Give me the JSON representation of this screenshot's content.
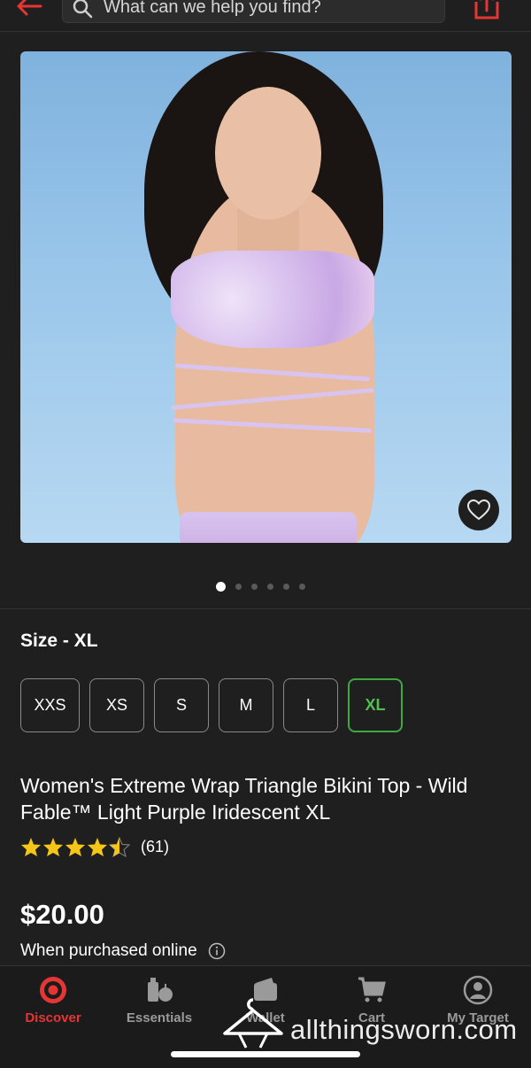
{
  "search": {
    "placeholder": "What can we help you find?"
  },
  "icons": {
    "back": "back-arrow-icon",
    "search": "search-icon",
    "share": "share-icon",
    "favorite": "heart-icon",
    "info": "info-icon"
  },
  "colors": {
    "accent": "#e63535",
    "selected_size": "#3fa83f",
    "star": "#f5c518",
    "background": "#1f1f1f"
  },
  "gallery": {
    "image_count": 6,
    "active_index": 0
  },
  "size": {
    "label": "Size - XL",
    "options": [
      "XXS",
      "XS",
      "S",
      "M",
      "L",
      "XL"
    ],
    "selected": "XL"
  },
  "product": {
    "title": "Women's Extreme Wrap Triangle Bikini Top - Wild Fable™ Light Purple Iridescent XL",
    "rating": 4.5,
    "rating_count": "(61)",
    "price": "$20.00",
    "purchase_note": "When purchased online"
  },
  "nav": {
    "items": [
      {
        "label": "Discover",
        "icon": "target-logo-icon",
        "active": true
      },
      {
        "label": "Essentials",
        "icon": "essentials-icon",
        "active": false
      },
      {
        "label": "Wallet",
        "icon": "wallet-icon",
        "active": false
      },
      {
        "label": "Cart",
        "icon": "cart-icon",
        "active": false
      },
      {
        "label": "My Target",
        "icon": "account-icon",
        "active": false
      }
    ]
  },
  "watermark": {
    "text": "allthingsworn.com"
  }
}
